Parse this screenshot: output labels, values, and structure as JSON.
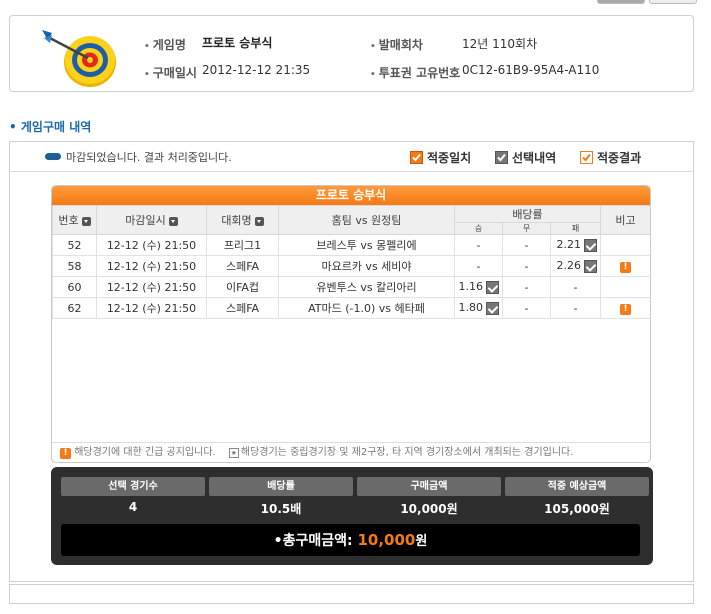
{
  "game_info": {
    "game_name_label": "게임명",
    "game_name_value": "프로토 승부식",
    "purchase_date_label": "구매일시",
    "purchase_date_value": "2012-12-12 21:35",
    "round_label": "발매회차",
    "round_value": "12년 110회차",
    "ticket_id_label": "투표권 고유번호",
    "ticket_id_value": "0C12-61B9-95A4-A110"
  },
  "section_title": "게임구매 내역",
  "status": {
    "text": "마감되었습니다. 결과 처리중입니다.",
    "legend": [
      {
        "label": "적중일치",
        "color": "#f47a15",
        "style": "filled-orange"
      },
      {
        "label": "선택내역",
        "color": "#777777",
        "style": "filled-gray"
      },
      {
        "label": "적중결과",
        "color": "#f47a15",
        "style": "outline-orange"
      }
    ]
  },
  "game_table": {
    "title": "프로토 승부식",
    "headers": {
      "no": "번호",
      "deadline": "마감일시",
      "league": "대회명",
      "teams": "홈팀 vs 원정팀",
      "odds": "배당률",
      "win": "승",
      "draw": "무",
      "lose": "패",
      "note": "비고"
    },
    "rows": [
      {
        "no": "52",
        "deadline": "12-12 (수) 21:50",
        "league": "프리그1",
        "teams": "브레스투 vs 몽펠리에",
        "win": "-",
        "draw": "-",
        "lose": "2.21",
        "selected": "lose",
        "warn": false
      },
      {
        "no": "58",
        "deadline": "12-12 (수) 21:50",
        "league": "스페FA",
        "teams": "마요르카 vs 세비야",
        "win": "-",
        "draw": "-",
        "lose": "2.26",
        "selected": "lose",
        "warn": true
      },
      {
        "no": "60",
        "deadline": "12-12 (수) 21:50",
        "league": "이FA컵",
        "teams": "유벤투스 vs 칼리아리",
        "win": "1.16",
        "draw": "-",
        "lose": "-",
        "selected": "win",
        "warn": false
      },
      {
        "no": "62",
        "deadline": "12-12 (수) 21:50",
        "league": "스페FA",
        "teams": "AT마드 (-1.0) vs 헤타페",
        "win": "1.80",
        "draw": "-",
        "lose": "-",
        "selected": "win",
        "warn": true
      }
    ],
    "note_warn_icon": "!",
    "note_warn": "해당경기에 대한 긴급 공지입니다.",
    "note_star_icon": "★",
    "note_star": "해당경기는 중립경기장 및 제2구장, 타 지역 경기장소에서 개최되는 경기입니다."
  },
  "summary": {
    "selected_count_label": "선택 경기수",
    "selected_count_value": "4",
    "odds_label": "배당률",
    "odds_value": "10.5배",
    "purchase_amount_label": "구매금액",
    "purchase_amount_value": "10,000원",
    "expected_label": "적중 예상금액",
    "expected_value": "105,000원",
    "total_label": "•총구매금액:",
    "total_amount": "10,000",
    "total_unit": "원"
  }
}
